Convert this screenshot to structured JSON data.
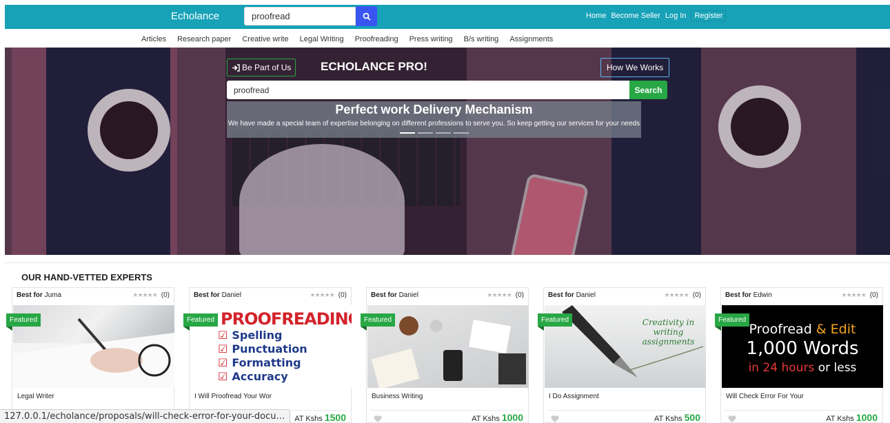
{
  "topbar": {
    "brand": "Echolance",
    "search_value": "proofread",
    "links": [
      "Home",
      "Become Seller",
      "Log In",
      "Register"
    ]
  },
  "categories": [
    "Articles",
    "Research paper",
    "Creative write",
    "Legal Writing",
    "Proofreading",
    "Press writing",
    "B/s writing",
    "Assignments"
  ],
  "hero": {
    "join_label": "Be Part of Us",
    "title": "ECHOLANCE PRO!",
    "how_label": "How We Works",
    "search_value": "proofread",
    "search_label": "Search",
    "caption_title": "Perfect work Delivery Mechanism",
    "caption_text": "We have made a special team of expertise belonging on different professions to serve you. So keep getting our services for your needs"
  },
  "section_title": "OUR HAND-VETTED EXPERTS",
  "common": {
    "best_for": "Best for",
    "featured": "Featured",
    "stars": "★★★★★",
    "price_prefix": "AT Kshs"
  },
  "cards": [
    {
      "expert": "Juma",
      "reviews": "(0)",
      "title": "Legal Writer",
      "price": ""
    },
    {
      "expert": "Daniel",
      "reviews": "(0)",
      "title": "I Will Proofread Your Wor",
      "price": "1500"
    },
    {
      "expert": "Daniel",
      "reviews": "(0)",
      "title": "Business Writing",
      "price": "1000"
    },
    {
      "expert": "Daniel",
      "reviews": "(0)",
      "title": "I Do Assignment",
      "price": "500"
    },
    {
      "expert": "Edwin",
      "reviews": "(0)",
      "title": "Will Check Error For Your",
      "price": "1000"
    }
  ],
  "proof_image": {
    "title": "PROOFREADING",
    "items": [
      "Spelling",
      "Punctuation",
      "Formatting",
      "Accuracy"
    ],
    "check": "☑"
  },
  "assign_image": {
    "line1": "Creativity in",
    "line2": "writing assignments"
  },
  "edit_image": {
    "a": "Proofread",
    "amp": "& Edit",
    "b": "1,000 Words",
    "c1": "in 24 hours",
    "c2": "or less"
  },
  "statusbar": "127.0.0.1/echolance/proposals/will-check-error-for-your-docu…",
  "colors": {
    "teal": "#17a2b8",
    "green": "#28a745",
    "blue": "#3a56f2"
  }
}
